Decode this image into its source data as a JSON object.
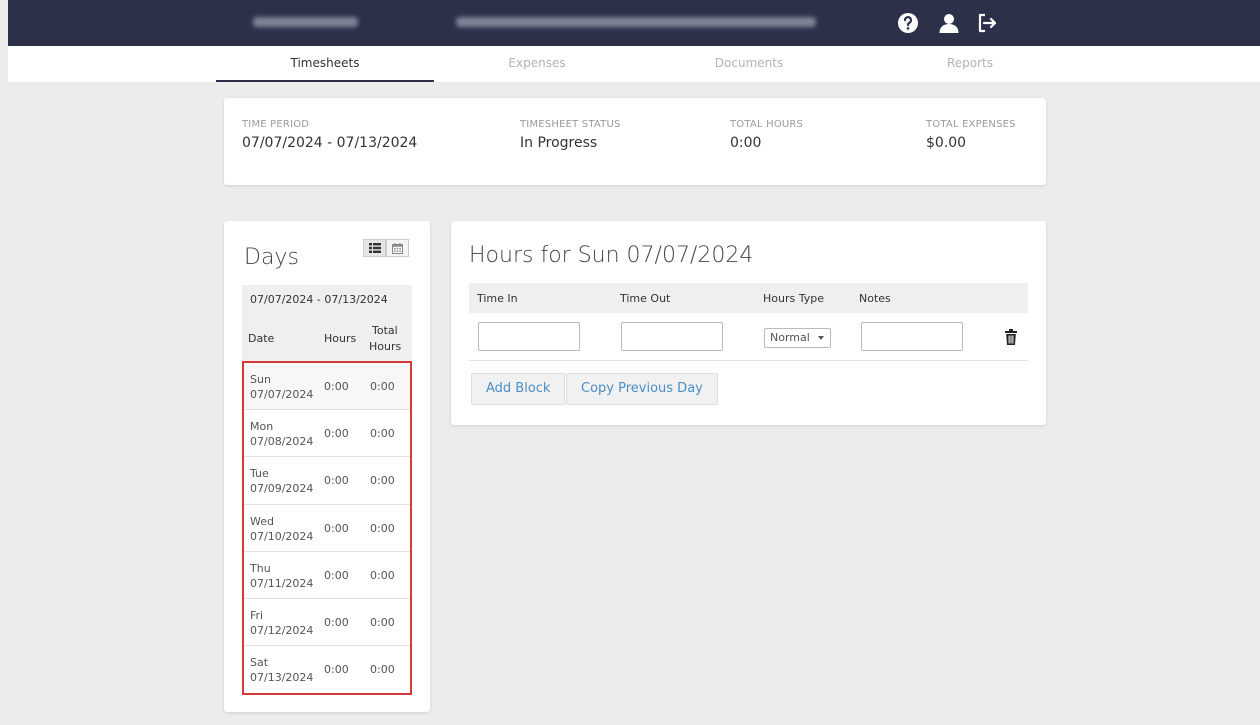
{
  "tabs": [
    {
      "label": "Timesheets"
    },
    {
      "label": "Expenses"
    },
    {
      "label": "Documents"
    },
    {
      "label": "Reports"
    }
  ],
  "icons": [
    "help-icon",
    "user-icon",
    "logout-icon",
    "list-view-icon",
    "calendar-view-icon",
    "trash-icon"
  ],
  "colors": {
    "topbar": "#2c3149",
    "link": "#4a8ec6",
    "highlight": "#d53a3a"
  },
  "summary": {
    "time_period_label": "TIME PERIOD",
    "time_period_value": "07/07/2024 - 07/13/2024",
    "status_label": "TIMESHEET STATUS",
    "status_value": "In Progress",
    "total_hours_label": "TOTAL HOURS",
    "total_hours_value": "0:00",
    "total_expenses_label": "TOTAL EXPENSES",
    "total_expenses_value": "$0.00"
  },
  "days_panel": {
    "title": "Days",
    "range": "07/07/2024 - 07/13/2024",
    "col_date": "Date",
    "col_hours": "Hours",
    "col_total_1": "Total",
    "col_total_2": "Hours",
    "rows": [
      {
        "day": "Sun",
        "date": "07/07/2024",
        "hours": "0:00",
        "total": "0:00"
      },
      {
        "day": "Mon",
        "date": "07/08/2024",
        "hours": "0:00",
        "total": "0:00"
      },
      {
        "day": "Tue",
        "date": "07/09/2024",
        "hours": "0:00",
        "total": "0:00"
      },
      {
        "day": "Wed",
        "date": "07/10/2024",
        "hours": "0:00",
        "total": "0:00"
      },
      {
        "day": "Thu",
        "date": "07/11/2024",
        "hours": "0:00",
        "total": "0:00"
      },
      {
        "day": "Fri",
        "date": "07/12/2024",
        "hours": "0:00",
        "total": "0:00"
      },
      {
        "day": "Sat",
        "date": "07/13/2024",
        "hours": "0:00",
        "total": "0:00"
      }
    ]
  },
  "hours_panel": {
    "title": "Hours for Sun 07/07/2024",
    "col_time_in": "Time In",
    "col_time_out": "Time Out",
    "col_hours_type": "Hours Type",
    "col_notes": "Notes",
    "time_in_value": "",
    "time_out_value": "",
    "hours_type_value": "Normal",
    "notes_value": "",
    "add_block_label": "Add Block",
    "copy_previous_label": "Copy Previous Day"
  }
}
